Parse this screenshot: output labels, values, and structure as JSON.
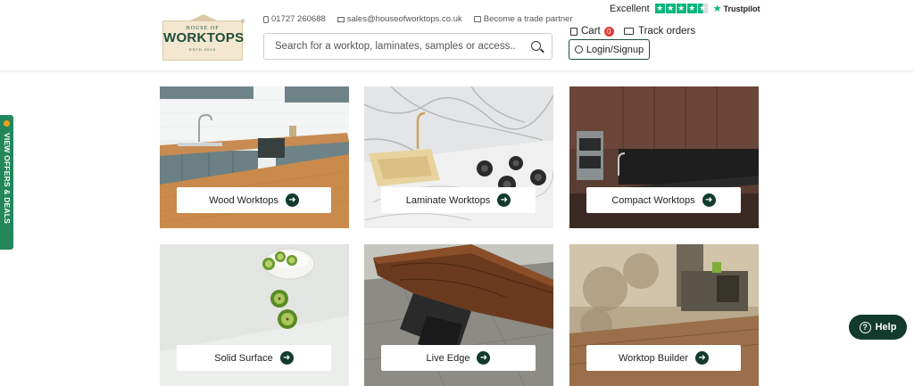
{
  "header": {
    "logo": {
      "top": "HOUSE OF",
      "main": "WORKTOPS",
      "bottom": "ESTD 2019"
    },
    "phone": "01727 260688",
    "email": "sales@houseofworktops.co.uk",
    "trade": "Become a trade partner",
    "search_placeholder": "Search for a worktop, laminates, samples or access...",
    "trustpilot": {
      "rating_text": "Excellent",
      "brand": "Trustpilot"
    },
    "cart_label": "Cart",
    "cart_count": "0",
    "track_label": "Track orders",
    "login_label": "Login/Signup"
  },
  "side_tab": {
    "label": "VIEW OFFERS & DEALS"
  },
  "categories": [
    {
      "label": "Wood Worktops"
    },
    {
      "label": "Laminate Worktops"
    },
    {
      "label": "Compact Worktops"
    },
    {
      "label": "Solid Surface"
    },
    {
      "label": "Live Edge"
    },
    {
      "label": "Worktop Builder"
    }
  ],
  "help": {
    "label": "Help"
  },
  "colors": {
    "brand_green": "#1f4d3a",
    "dark_green": "#123b2c",
    "offers_green": "#23875a",
    "trustpilot_green": "#00b67a"
  }
}
